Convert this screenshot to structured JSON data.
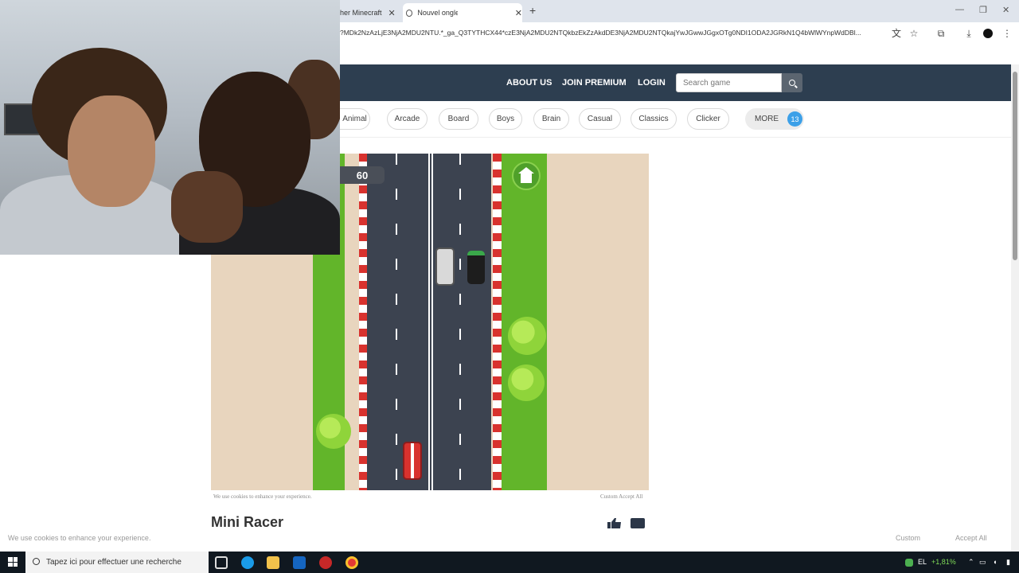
{
  "browser": {
    "tabs": [
      {
        "title": "her Minecraft",
        "active": false
      },
      {
        "title": "Nouvel onglet",
        "active": true
      }
    ],
    "url": "?MDk2NzAzLjE3NjA2MDU2NTU.*_ga_Q3TYTHCX44*czE3NjA2MDU2NTQkbzEkZzAkdDE3NjA2MDU2NTQkajYwJGwwJGgxOTg0NDI1ODA2JGRkN1Q4bWlWYnpWdDBl..."
  },
  "site": {
    "nav": {
      "about": "ABOUT US",
      "premium": "JOIN PREMIUM",
      "login": "LOGIN"
    },
    "search": {
      "placeholder": "Search game"
    },
    "categories": [
      "Animal",
      "Arcade",
      "Board",
      "Boys",
      "Brain",
      "Casual",
      "Classics",
      "Clicker"
    ],
    "more": {
      "label": "MORE",
      "count": "13"
    }
  },
  "game": {
    "title": "Mini Racer",
    "score": "60",
    "cookie_text": "We use cookies to enhance your experience.",
    "cookie_actions": "Custom Accept All"
  },
  "cookie_banner": {
    "text": "We use cookies to enhance your experience.",
    "custom": "Custom",
    "accept": "Accept All"
  },
  "taskbar": {
    "search_placeholder": "Tapez ici pour effectuer une recherche",
    "tray_lang": "EL",
    "tray_stock": "+1,81%"
  },
  "colors": {
    "header": "#2d3e50",
    "badge": "#3ca0e8",
    "grass": "#62b52a",
    "road": "#3c4350",
    "sand": "#e8d5be"
  }
}
